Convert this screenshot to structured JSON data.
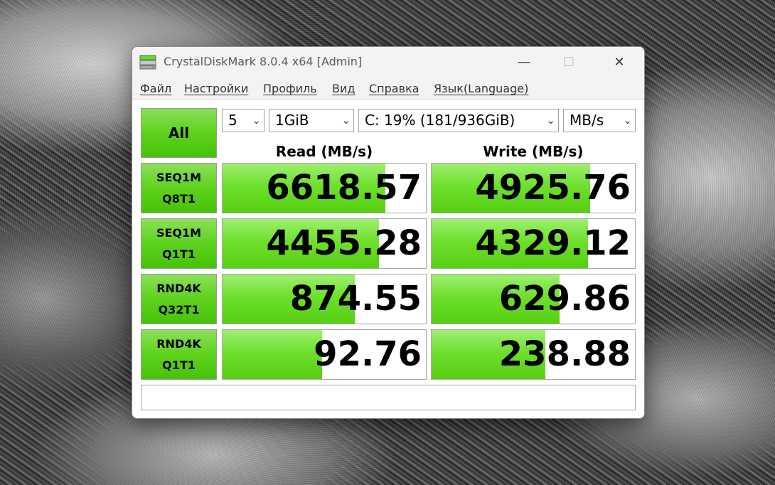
{
  "window": {
    "title": "CrystalDiskMark 8.0.4 x64 [Admin]"
  },
  "menu": [
    "Файл",
    "Настройки",
    "Профиль",
    "Вид",
    "Справка",
    "Язык(Language)"
  ],
  "controls": {
    "all_label": "All",
    "count": "5",
    "size": "1GiB",
    "drive": "C: 19% (181/936GiB)",
    "unit": "MB/s"
  },
  "headers": {
    "read": "Read (MB/s)",
    "write": "Write (MB/s)"
  },
  "tests": [
    {
      "line1": "SEQ1M",
      "line2": "Q8T1",
      "read": "6618.57",
      "write": "4925.76",
      "read_level": 0.8,
      "write_level": 0.78
    },
    {
      "line1": "SEQ1M",
      "line2": "Q1T1",
      "read": "4455.28",
      "write": "4329.12",
      "read_level": 0.77,
      "write_level": 0.77
    },
    {
      "line1": "RND4K",
      "line2": "Q32T1",
      "read": "874.55",
      "write": "629.86",
      "read_level": 0.65,
      "write_level": 0.63
    },
    {
      "line1": "RND4K",
      "line2": "Q1T1",
      "read": "92.76",
      "write": "238.88",
      "read_level": 0.49,
      "write_level": 0.56
    }
  ],
  "comment": "",
  "colors": {
    "bar_green": "#56cf12",
    "button_green": "#5ed21d"
  }
}
